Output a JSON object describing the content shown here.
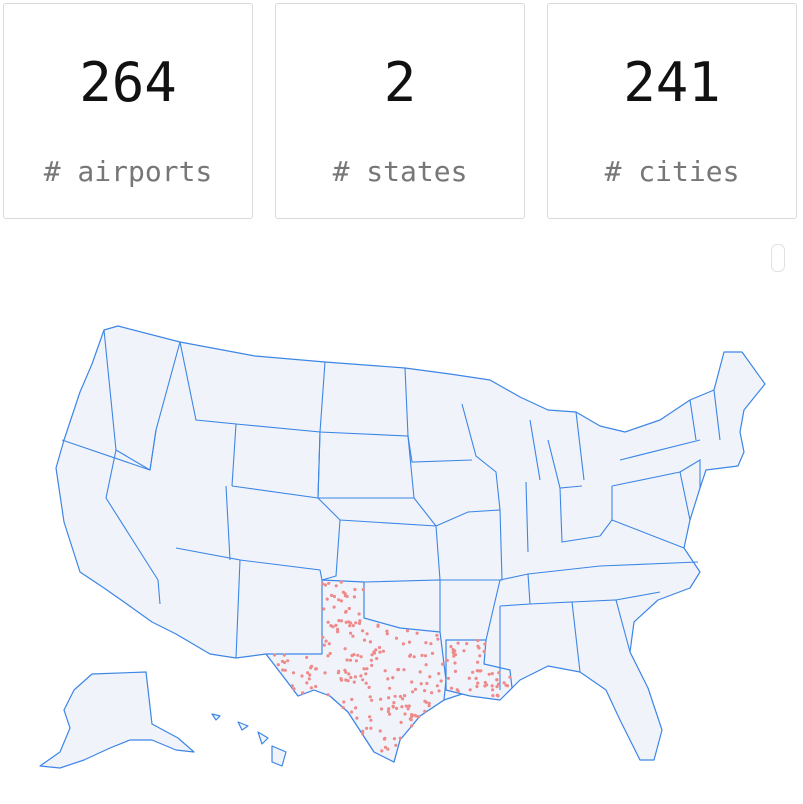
{
  "kpis": [
    {
      "value": "264",
      "label": "# airports"
    },
    {
      "value": "2",
      "label": "# states"
    },
    {
      "value": "241",
      "label": "# cities"
    }
  ],
  "map": {
    "highlighted_states": [
      "TX",
      "LA"
    ],
    "colors": {
      "land": "#f0f4fa",
      "border": "#3d86e6",
      "airport": "#ef8a8a"
    }
  }
}
